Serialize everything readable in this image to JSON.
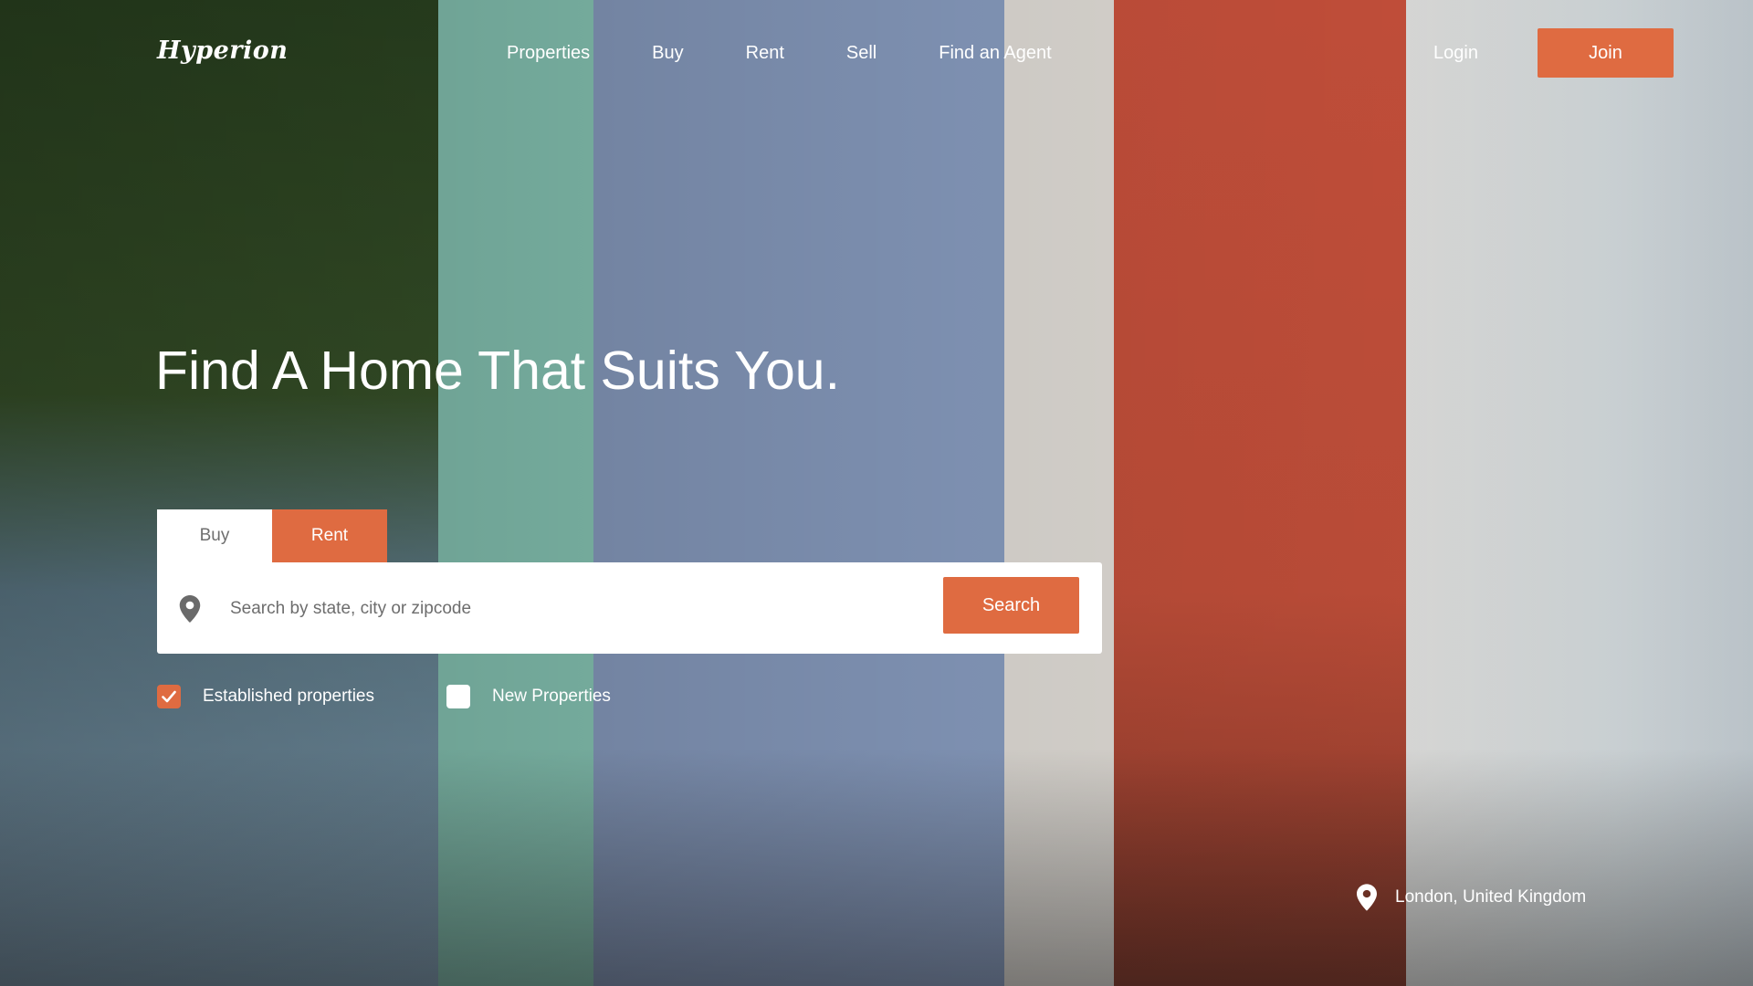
{
  "brand": {
    "logo_text": "Hyperion"
  },
  "nav": {
    "items": [
      {
        "label": "Properties"
      },
      {
        "label": "Buy"
      },
      {
        "label": "Rent"
      },
      {
        "label": "Sell"
      },
      {
        "label": "Find an Agent"
      }
    ],
    "login_label": "Login",
    "join_label": "Join"
  },
  "hero": {
    "title": "Find A Home That Suits You."
  },
  "search": {
    "tabs": [
      {
        "label": "Buy",
        "active": false
      },
      {
        "label": "Rent",
        "active": true
      }
    ],
    "placeholder": "Search by state, city or zipcode",
    "value": "",
    "button_label": "Search",
    "options": [
      {
        "label": "Established properties",
        "checked": true
      },
      {
        "label": "New Properties",
        "checked": false
      }
    ]
  },
  "location": {
    "label": "London, United Kingdom"
  },
  "icons": {
    "search_pin": "map-pin-icon",
    "checkmark": "check-icon",
    "location_pin": "map-pin-icon"
  },
  "colors": {
    "accent": "#df6b41",
    "white": "#ffffff",
    "tab_inactive_text": "#6e6e6e",
    "placeholder_text": "#6d6d6d",
    "pin_icon": "#6a6a6a"
  }
}
